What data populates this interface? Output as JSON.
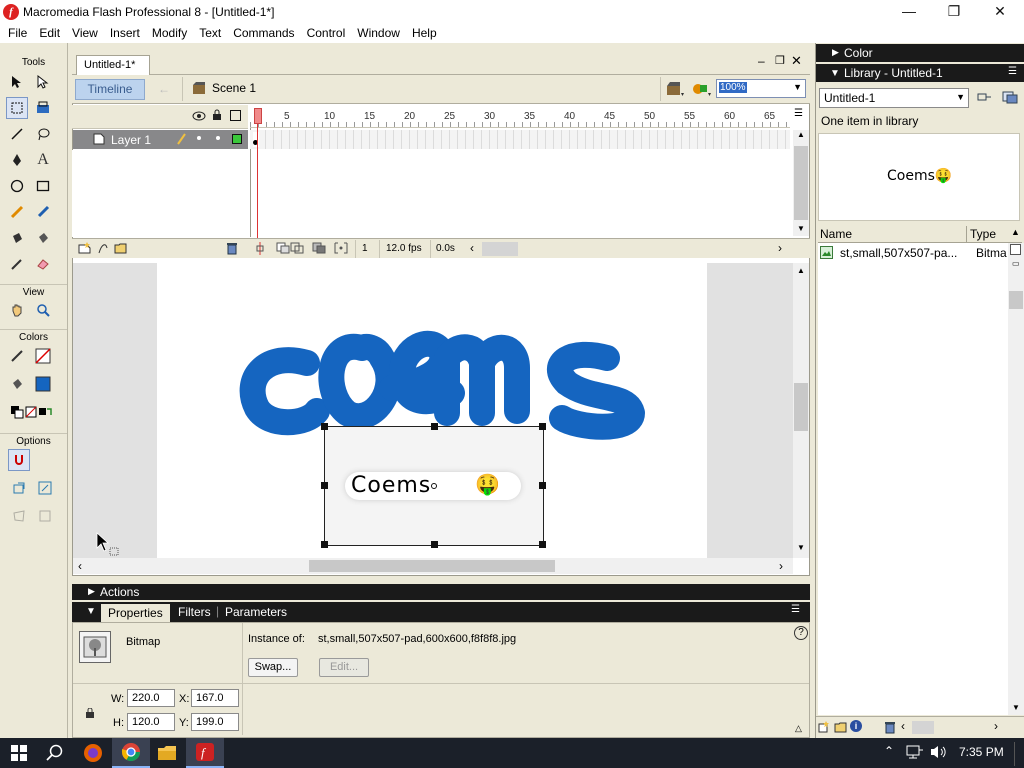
{
  "app": {
    "title": "Macromedia Flash Professional 8 - [Untitled-1*]",
    "icon": "flash-app-icon",
    "accent": "#316ac5"
  },
  "menu": [
    "File",
    "Edit",
    "View",
    "Insert",
    "Modify",
    "Text",
    "Commands",
    "Control",
    "Window",
    "Help"
  ],
  "tools": {
    "title": "Tools",
    "view_label": "View",
    "colors_label": "Colors",
    "options_label": "Options",
    "fill_color": "#1565c0"
  },
  "document": {
    "tab": "Untitled-1*",
    "timeline_button": "Timeline",
    "scene": "Scene 1",
    "zoom": "100%"
  },
  "timeline": {
    "layer_name": "Layer 1",
    "ruler_ticks": [
      "1",
      "5",
      "10",
      "15",
      "20",
      "25",
      "30",
      "35",
      "40",
      "45",
      "50",
      "55",
      "60",
      "65"
    ],
    "current_frame": "1",
    "fps": "12.0 fps",
    "time": "0.0s"
  },
  "stage": {
    "handwritten_text": "coems",
    "bitmap_text": "Coems",
    "bitmap_emoji": "🤑",
    "ink_color": "#1565c0"
  },
  "actions_panel": {
    "label": "Actions"
  },
  "properties": {
    "tabs": [
      "Properties",
      "Filters",
      "Parameters"
    ],
    "type": "Bitmap",
    "instance_label": "Instance of:",
    "instance_value": "st,small,507x507-pad,600x600,f8f8f8.jpg",
    "swap_label": "Swap...",
    "edit_label": "Edit...",
    "w_label": "W:",
    "w_value": "220.0",
    "h_label": "H:",
    "h_value": "120.0",
    "x_label": "X:",
    "x_value": "167.0",
    "y_label": "Y:",
    "y_value": "199.0"
  },
  "right_panel": {
    "color_header": "Color",
    "library_header": "Library - Untitled-1",
    "library_select": "Untitled-1",
    "count": "One item in library",
    "preview_text": "Coems🤑",
    "col_name": "Name",
    "col_type": "Type",
    "item_name": "st,small,507x507-pa...",
    "item_type": "Bitma"
  },
  "taskbar": {
    "clock": "7:35 PM",
    "apps": [
      "start-icon",
      "search-icon",
      "firefox-icon",
      "chrome-icon",
      "file-explorer-icon",
      "flash-icon"
    ]
  }
}
